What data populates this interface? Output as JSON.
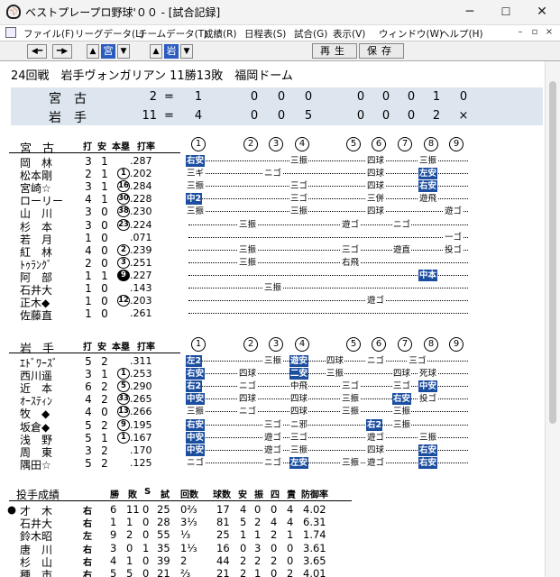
{
  "window": {
    "title": "ベストプレープロ野球'００ - [試合記録]",
    "controls": [
      "─",
      "☐",
      "✕"
    ]
  },
  "menu": [
    "ファイル(F)",
    "リーグデータ(L)",
    "チームデータ(T)",
    "成績(R)",
    "日程表(S)",
    "試合(G)",
    "表示(V)",
    "ウィンドウ(W)",
    "ヘルプ(H)"
  ],
  "mdi_controls": [
    "–",
    "▫",
    "×"
  ],
  "toolbar": {
    "team1_tag": "宮",
    "team2_tag": "岩",
    "replay_label": "再生",
    "save_label": "保存"
  },
  "game": {
    "title": "24回戦　岩手ヴォンガリアン 11勝13敗　福岡ドーム",
    "away": {
      "name": "宮古",
      "runs": "2",
      "innings": [
        "1",
        "0",
        "0",
        "0",
        "0",
        "0",
        "0",
        "1",
        "0"
      ]
    },
    "home": {
      "name": "岩手",
      "runs": "11",
      "innings": [
        "4",
        "0",
        "0",
        "5",
        "0",
        "0",
        "0",
        "2",
        "×"
      ]
    }
  },
  "columns": {
    "at_bats": "打",
    "hits": "安",
    "hr": "本塁",
    "avg": "打率"
  },
  "inning_numbers": [
    "1",
    "2",
    "3",
    "4",
    "5",
    "6",
    "7",
    "8",
    "9"
  ],
  "away_batting": {
    "team_label": "宮古",
    "rows": [
      {
        "name": "岡　林",
        "ab": "3",
        "h": "1",
        "hr": "",
        "avg": ".287",
        "results": [
          {
            "inn": 1,
            "text": "右安",
            "hit": true
          },
          {
            "inn": 4,
            "text": "三振"
          },
          {
            "inn": 6,
            "text": "四球"
          },
          {
            "inn": 8,
            "text": "三振"
          }
        ]
      },
      {
        "name": "松本剛",
        "ab": "2",
        "h": "1",
        "hr": "1",
        "avg": ".202",
        "results": [
          {
            "inn": 1,
            "text": "三ギ"
          },
          {
            "inn": 3,
            "text": "ニゴ"
          },
          {
            "inn": 6,
            "text": "四球"
          },
          {
            "inn": 8,
            "text": "左安",
            "hit": true
          }
        ]
      },
      {
        "name": "宮崎☆",
        "ab": "3",
        "h": "1",
        "hr": "16",
        "avg": ".284",
        "results": [
          {
            "inn": 1,
            "text": "三振"
          },
          {
            "inn": 4,
            "text": "三ゴ"
          },
          {
            "inn": 6,
            "text": "四球"
          },
          {
            "inn": 8,
            "text": "右安",
            "hit": true
          }
        ]
      },
      {
        "name": "ローリー",
        "ab": "4",
        "h": "1",
        "hr": "30",
        "avg": ".228",
        "results": [
          {
            "inn": 1,
            "text": "中2",
            "hit": true
          },
          {
            "inn": 4,
            "text": "三ゴ"
          },
          {
            "inn": 6,
            "text": "三併"
          },
          {
            "inn": 8,
            "text": "遊飛"
          }
        ]
      },
      {
        "name": "山　川",
        "ab": "3",
        "h": "0",
        "hr": "38",
        "avg": ".230",
        "results": [
          {
            "inn": 1,
            "text": "三振"
          },
          {
            "inn": 4,
            "text": "三振"
          },
          {
            "inn": 6,
            "text": "四球"
          },
          {
            "inn": 9,
            "text": "遊ゴ"
          }
        ]
      },
      {
        "name": "杉　本",
        "ab": "3",
        "h": "0",
        "hr": "23",
        "avg": ".224",
        "results": [
          {
            "inn": 2,
            "text": "三振"
          },
          {
            "inn": 5,
            "text": "遊ゴ"
          },
          {
            "inn": 7,
            "text": "ニゴ"
          }
        ]
      },
      {
        "name": "若　月",
        "ab": "1",
        "h": "0",
        "hr": "",
        "avg": ".071",
        "results": [
          {
            "inn": 9,
            "text": "一ゴ"
          }
        ]
      },
      {
        "name": "紅　林",
        "ab": "4",
        "h": "0",
        "hr": "2",
        "avg": ".239",
        "results": [
          {
            "inn": 2,
            "text": "三振"
          },
          {
            "inn": 5,
            "text": "三ゴ"
          },
          {
            "inn": 7,
            "text": "遊直"
          },
          {
            "inn": 9,
            "text": "投ゴ"
          }
        ]
      },
      {
        "name": "ﾄｩﾗﾝｸﾞ",
        "ab": "2",
        "h": "0",
        "hr": "3",
        "avg": ".251",
        "results": [
          {
            "inn": 2,
            "text": "三振"
          },
          {
            "inn": 5,
            "text": "右飛"
          }
        ]
      },
      {
        "name": "阿　部",
        "ab": "1",
        "h": "1",
        "hr": "9",
        "avg": ".227",
        "hrFilled": true,
        "results": [
          {
            "inn": 8,
            "text": "中本",
            "hit": true
          }
        ]
      },
      {
        "name": "石井大",
        "ab": "1",
        "h": "0",
        "hr": "",
        "avg": ".143",
        "results": [
          {
            "inn": 3,
            "text": "三振"
          }
        ]
      },
      {
        "name": "正木◆",
        "ab": "1",
        "h": "0",
        "hr": "12",
        "avg": ".203",
        "results": [
          {
            "inn": 6,
            "text": "遊ゴ"
          }
        ]
      },
      {
        "name": "佐藤直",
        "ab": "1",
        "h": "0",
        "hr": "",
        "avg": ".261",
        "results": []
      }
    ]
  },
  "home_batting": {
    "team_label": "岩手",
    "rows": [
      {
        "name": "ｴﾄﾞﾜｰｽﾞ",
        "ab": "5",
        "h": "2",
        "hr": "",
        "avg": ".311",
        "results": [
          {
            "inn": 1,
            "text": "左2",
            "hit": true
          },
          {
            "inn": 3,
            "text": "三振"
          },
          {
            "inn": 4,
            "text": "遊安",
            "hit": true
          },
          {
            "inn": 4.7,
            "text": "四球"
          },
          {
            "inn": 6,
            "text": "ニゴ"
          },
          {
            "inn": 7.6,
            "text": "三ゴ"
          }
        ]
      },
      {
        "name": "西川遥",
        "ab": "3",
        "h": "1",
        "hr": "1",
        "avg": ".253",
        "results": [
          {
            "inn": 1,
            "text": "右安",
            "hit": true
          },
          {
            "inn": 2,
            "text": "四球"
          },
          {
            "inn": 4,
            "text": "二安",
            "hit": true
          },
          {
            "inn": 4.7,
            "text": "三振"
          },
          {
            "inn": 7,
            "text": "四球"
          },
          {
            "inn": 8,
            "text": "死球"
          }
        ]
      },
      {
        "name": "近　本",
        "ab": "6",
        "h": "2",
        "hr": "5",
        "avg": ".290",
        "results": [
          {
            "inn": 1,
            "text": "右2",
            "hit": true
          },
          {
            "inn": 2,
            "text": "ニゴ"
          },
          {
            "inn": 4,
            "text": "中飛"
          },
          {
            "inn": 5,
            "text": "三ゴ"
          },
          {
            "inn": 7,
            "text": "三ゴ"
          },
          {
            "inn": 8,
            "text": "中安",
            "hit": true
          }
        ]
      },
      {
        "name": "ｵｰｽﾃｨﾝ",
        "ab": "4",
        "h": "2",
        "hr": "33",
        "avg": ".265",
        "results": [
          {
            "inn": 1,
            "text": "中安",
            "hit": true
          },
          {
            "inn": 2,
            "text": "四球"
          },
          {
            "inn": 4,
            "text": "四球"
          },
          {
            "inn": 5,
            "text": "三振"
          },
          {
            "inn": 7,
            "text": "右安",
            "hit": true
          },
          {
            "inn": 8,
            "text": "投ゴ"
          }
        ]
      },
      {
        "name": "牧　◆",
        "ab": "4",
        "h": "0",
        "hr": "13",
        "avg": ".266",
        "results": [
          {
            "inn": 1,
            "text": "三振"
          },
          {
            "inn": 2,
            "text": "ニゴ"
          },
          {
            "inn": 4,
            "text": "四球"
          },
          {
            "inn": 5,
            "text": "三振"
          },
          {
            "inn": 7,
            "text": "三振"
          }
        ]
      },
      {
        "name": "坂倉◆",
        "ab": "5",
        "h": "2",
        "hr": "9",
        "avg": ".195",
        "results": [
          {
            "inn": 1,
            "text": "右安",
            "hit": true
          },
          {
            "inn": 3,
            "text": "三ゴ"
          },
          {
            "inn": 4,
            "text": "ニ邪"
          },
          {
            "inn": 6,
            "text": "右2",
            "hit": true
          },
          {
            "inn": 7,
            "text": "三振"
          }
        ]
      },
      {
        "name": "浅　野",
        "ab": "5",
        "h": "1",
        "hr": "1",
        "avg": ".167",
        "results": [
          {
            "inn": 1,
            "text": "中安",
            "hit": true
          },
          {
            "inn": 3,
            "text": "遊ゴ"
          },
          {
            "inn": 4,
            "text": "三ゴ"
          },
          {
            "inn": 6,
            "text": "遊ゴ"
          },
          {
            "inn": 8,
            "text": "三振"
          }
        ]
      },
      {
        "name": "周　東",
        "ab": "3",
        "h": "2",
        "hr": "",
        "avg": ".170",
        "results": [
          {
            "inn": 1,
            "text": "中安",
            "hit": true
          },
          {
            "inn": 3,
            "text": "遊ゴ"
          },
          {
            "inn": 4,
            "text": "三振"
          },
          {
            "inn": 6,
            "text": "四球"
          },
          {
            "inn": 8,
            "text": "右安",
            "hit": true
          }
        ]
      },
      {
        "name": "隅田☆",
        "ab": "5",
        "h": "2",
        "hr": "",
        "avg": ".125",
        "results": [
          {
            "inn": 1,
            "text": "ニゴ"
          },
          {
            "inn": 3,
            "text": "ニゴ"
          },
          {
            "inn": 4,
            "text": "左安",
            "hit": true
          },
          {
            "inn": 5,
            "text": "三振"
          },
          {
            "inn": 6,
            "text": "遊ゴ"
          },
          {
            "inn": 8,
            "text": "右安",
            "hit": true
          }
        ]
      }
    ]
  },
  "pitching": {
    "label": "投手成績",
    "headers": [
      "勝",
      "敗",
      "S",
      "試",
      "回数",
      "球数",
      "安",
      "振",
      "四",
      "責",
      "防御率"
    ],
    "rows": [
      {
        "mark": "●",
        "name": "才　木",
        "hand": "右",
        "w": "6",
        "l": "11",
        "s": "0",
        "g": "25",
        "ip": "0⅔",
        "pc": "17",
        "h": "4",
        "k": "0",
        "bb": "0",
        "er": "4",
        "era": "4.02"
      },
      {
        "mark": "",
        "name": "石井大",
        "hand": "右",
        "w": "1",
        "l": "1",
        "s": "0",
        "g": "28",
        "ip": "3⅓",
        "pc": "81",
        "h": "5",
        "k": "2",
        "bb": "4",
        "er": "4",
        "era": "6.31"
      },
      {
        "mark": "",
        "name": "鈴木昭",
        "hand": "左",
        "w": "9",
        "l": "2",
        "s": "0",
        "g": "55",
        "ip": "⅓",
        "pc": "25",
        "h": "1",
        "k": "1",
        "bb": "2",
        "er": "1",
        "era": "1.74"
      },
      {
        "mark": "",
        "name": "唐　川",
        "hand": "右",
        "w": "3",
        "l": "0",
        "s": "1",
        "g": "35",
        "ip": "1⅓",
        "pc": "16",
        "h": "0",
        "k": "3",
        "bb": "0",
        "er": "0",
        "era": "3.61"
      },
      {
        "mark": "",
        "name": "杉　山",
        "hand": "右",
        "w": "4",
        "l": "1",
        "s": "0",
        "g": "39",
        "ip": "2",
        "pc": "44",
        "h": "2",
        "k": "2",
        "bb": "2",
        "er": "0",
        "era": "3.65"
      },
      {
        "mark": "",
        "name": "種　市",
        "hand": "右",
        "w": "5",
        "l": "5",
        "s": "0",
        "g": "21",
        "ip": "⅔",
        "pc": "21",
        "h": "2",
        "k": "1",
        "bb": "0",
        "er": "2",
        "era": "4.01"
      }
    ]
  }
}
